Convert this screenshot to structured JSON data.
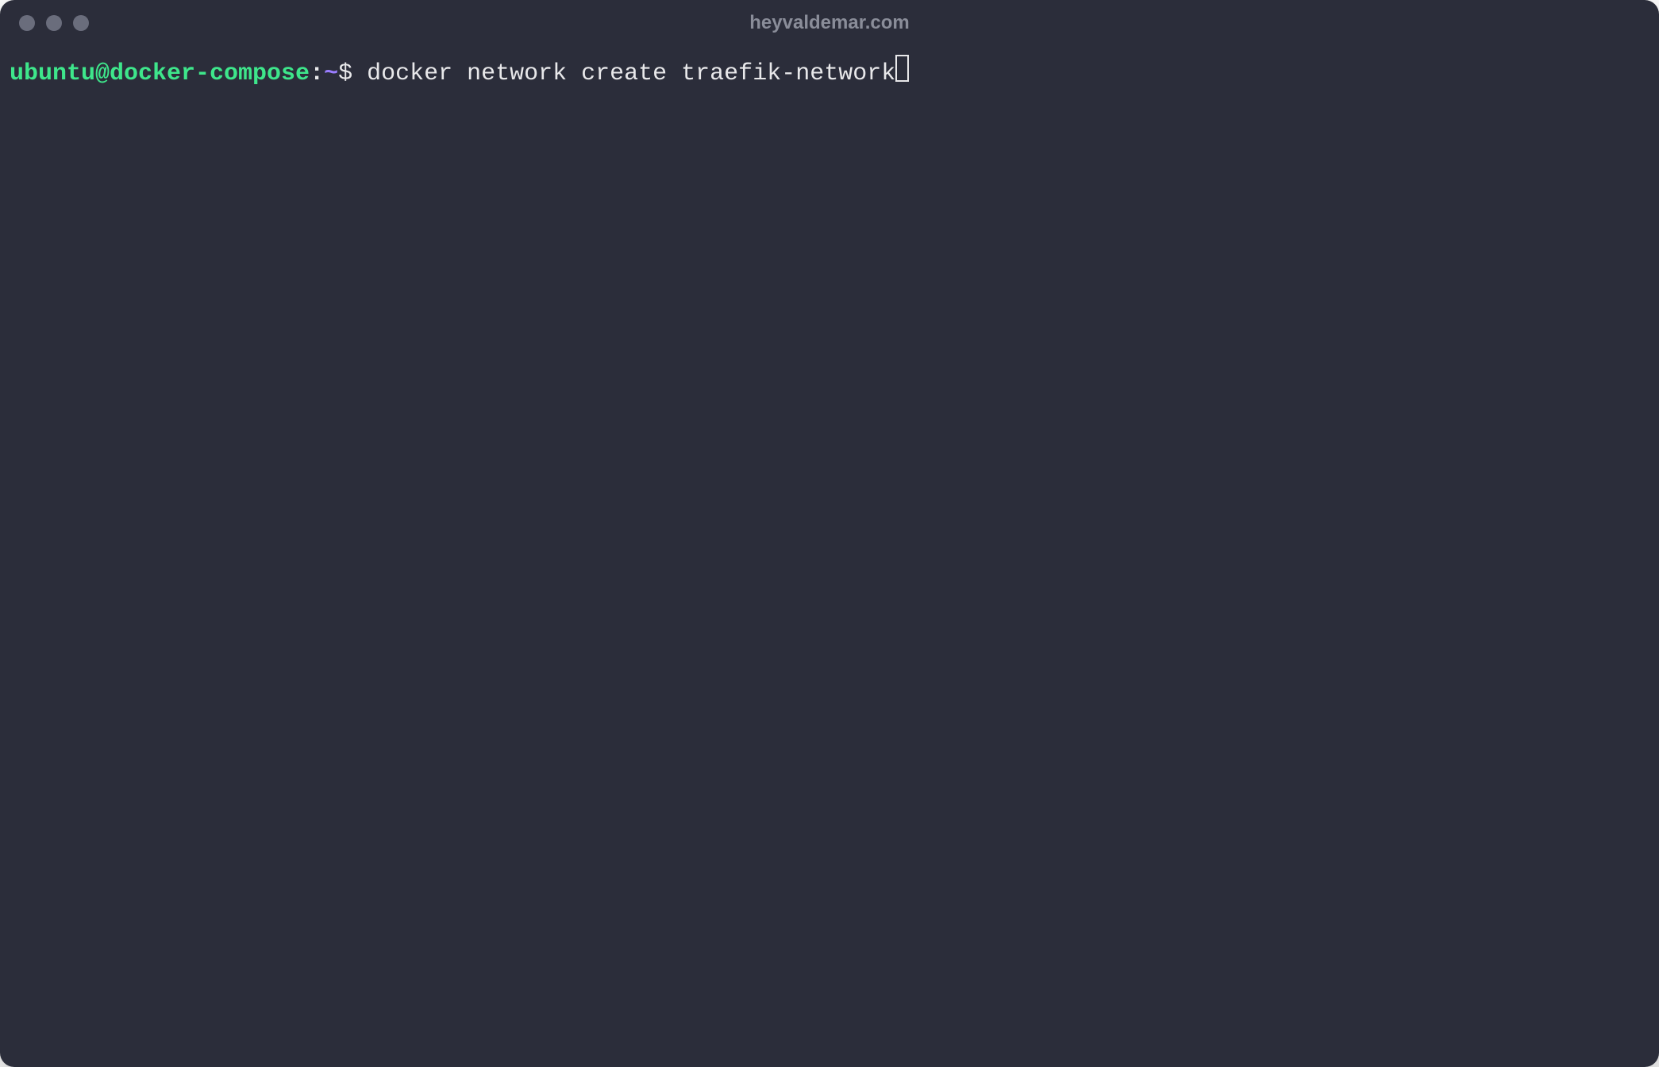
{
  "window": {
    "title": "heyvaldemar.com"
  },
  "prompt": {
    "user_host": "ubuntu@docker-compose",
    "colon": ":",
    "path": "~",
    "symbol": "$ "
  },
  "command": {
    "text": "docker network create traefik-network"
  },
  "colors": {
    "background": "#2b2d3a",
    "prompt_user_host": "#3ee68b",
    "prompt_path": "#9a7dff",
    "text": "#e8e8ea",
    "title": "#8a8d99",
    "traffic_dot": "#6a6d7c"
  }
}
